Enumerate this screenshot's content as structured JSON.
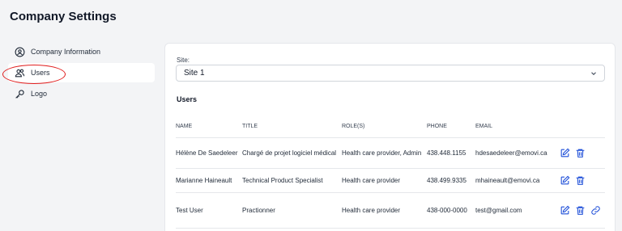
{
  "page": {
    "title": "Company Settings"
  },
  "sidebar": {
    "items": [
      {
        "label": "Company Information",
        "icon": "user-circle-icon"
      },
      {
        "label": "Users",
        "icon": "users-icon",
        "active": true
      },
      {
        "label": "Logo",
        "icon": "key-icon"
      }
    ]
  },
  "site": {
    "label": "Site:",
    "value": "Site 1"
  },
  "users": {
    "heading": "Users",
    "columns": [
      "NAME",
      "TITLE",
      "ROLE(S)",
      "PHONE",
      "EMAIL"
    ],
    "rows": [
      {
        "name": "Hélène De Saedeleer",
        "title": "Chargé de projet logiciel médical",
        "roles": "Health care provider, Admin",
        "phone": "438.448.1155",
        "email": "hdesaedeleer@emovi.ca",
        "has_link": false
      },
      {
        "name": "Marianne Haineault",
        "title": "Technical Product Specialist",
        "roles": "Health care provider",
        "phone": "438.499.9335",
        "email": "mhaineault@emovi.ca",
        "has_link": false
      },
      {
        "name": "Test User",
        "title": "Practionner",
        "roles": "Health care provider",
        "phone": "438-000-0000",
        "email": "test@gmail.com",
        "has_link": true
      }
    ]
  },
  "colors": {
    "accent": "#1d4ed8",
    "highlight": "#e11d1d"
  }
}
